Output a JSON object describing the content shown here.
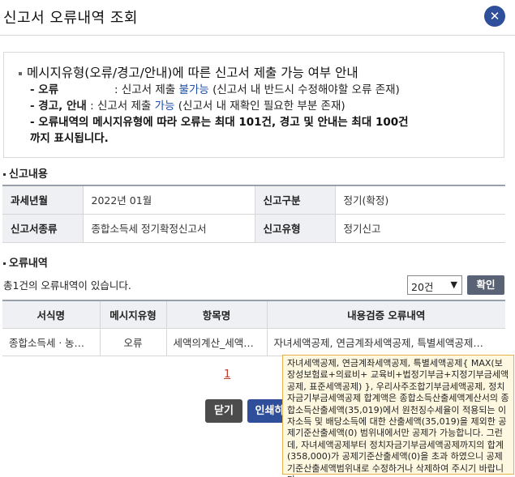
{
  "header": {
    "title": "신고서 오류내역 조회",
    "close_label": "✕"
  },
  "notice": {
    "title": "메시지유형(오류/경고/안내)에 따른 신고서 제출 가능 여부 안내",
    "error_label": "- 오류",
    "error_prefix": ": 신고서 제출 ",
    "error_highlight": "불가능",
    "error_suffix": " (신고서 내 반드시 수정해야할 오류 존재)",
    "warn_label": "- 경고, 안내",
    "warn_prefix": " : 신고서 제출 ",
    "warn_highlight": "가능",
    "warn_suffix": " (신고서 내 재확인 필요한 부분 존재)",
    "limit_line1": "- 오류내역의 메시지유형에 따라 오류는 최대 101건, 경고 및 안내는 최대 100건",
    "limit_line2": "까지 표시됩니다."
  },
  "report_section": {
    "title": "신고내용",
    "rows": [
      {
        "label1": "과세년월",
        "value1": "2022년 01월",
        "label2": "신고구분",
        "value2": "정기(확정)"
      },
      {
        "label1": "신고서종류",
        "value1": "종합소득세 정기확정신고서",
        "label2": "신고유형",
        "value2": "정기신고"
      }
    ]
  },
  "error_section": {
    "title": "오류내역",
    "count_text": "총1건의 오류내역이 있습니다.",
    "page_size": "20건",
    "confirm_label": "확인",
    "columns": [
      "서식명",
      "메시지유형",
      "항목명",
      "내용검증 오류내역"
    ],
    "rows": [
      {
        "form": "종합소득세ㆍ농…",
        "type": "오류",
        "item": "세액의계산_세액…",
        "detail": "자녀세액공제, 연금계좌세액공제, 특별세액공제…"
      }
    ]
  },
  "pagination": {
    "current": "1"
  },
  "buttons": {
    "close": "닫기",
    "print": "인쇄하"
  },
  "tooltip": {
    "text": "자녀세액공제, 연금계좌세액공제, 특별세액공제{ MAX(보장성보험료+의료비+ 교육비+법정기부금+지정기부금세액공제, 표준세액공제) }, 우리사주조합기부금세액공제, 정치자금기부금세액공제 합계액은 종합소득산출세액계산서의 종합소득산출세액(35,019)에서 원천징수세율이 적용되는 이자소득 및 배당소득에 대한 산출세액(35,019)을 제외한 공제기준산출세액(0) 범위내에서만 공제가 가능합니다. 그런데, 자녀세액공제부터 정치자금기부금세액공제까지의 합계(358,000)가 공제기준산출세액(0)을 초과 하였으니 공제기준산출세액범위내로 수정하거나 삭제하여 주시기 바랍니다."
  }
}
